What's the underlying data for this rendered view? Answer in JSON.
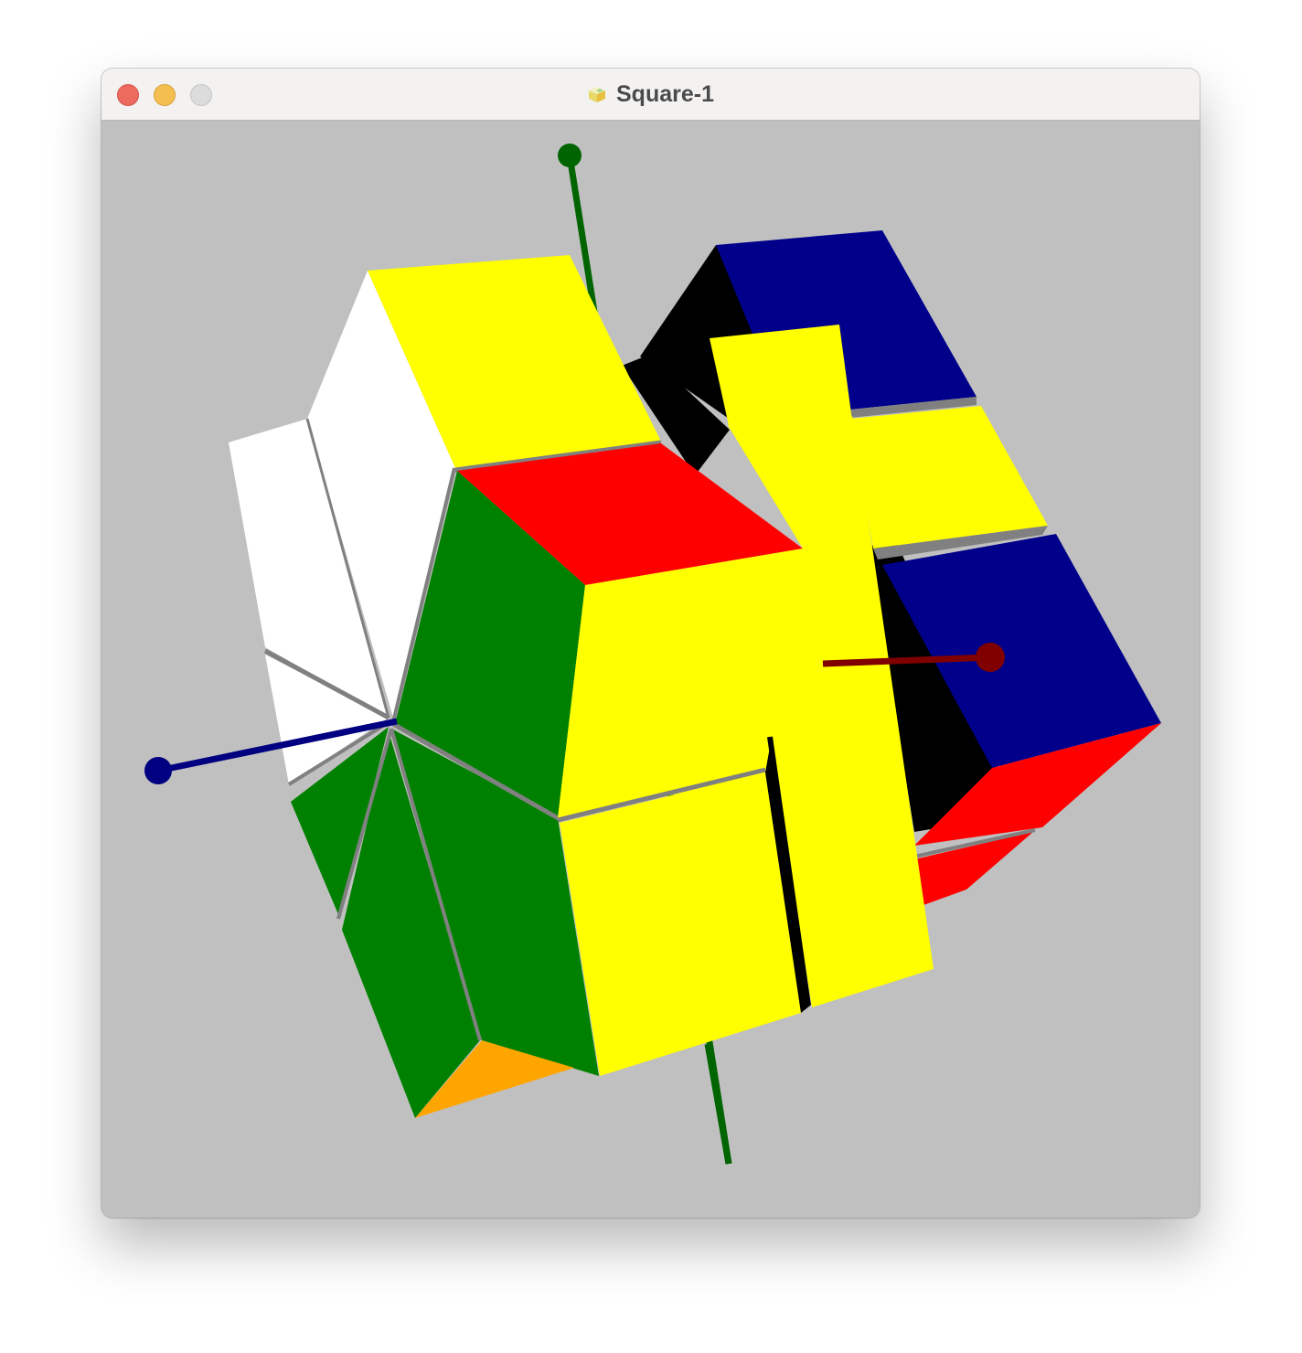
{
  "window": {
    "title": "Square-1",
    "title_icon": "cube-icon"
  },
  "canvas": {
    "background": "#c0c0c0",
    "axes": {
      "vertical": {
        "color": "#006400"
      },
      "horizontal": {
        "color": "#000080"
      },
      "depth": {
        "color": "#800000"
      }
    },
    "colors": {
      "yellow": "#ffff00",
      "white": "#ffffff",
      "green": "#008000",
      "red": "#ff0000",
      "blue": "#00008b",
      "black": "#000000",
      "orange": "#ffa500",
      "seam": "#808080"
    }
  }
}
